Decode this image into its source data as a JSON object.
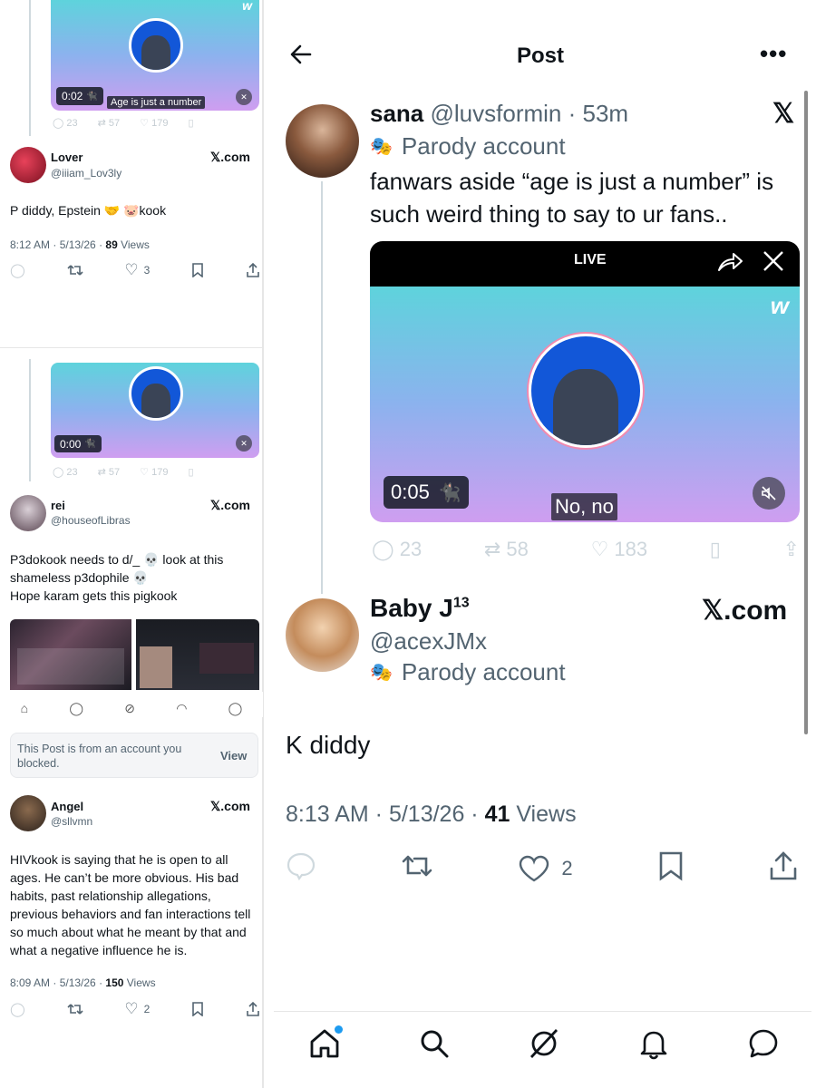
{
  "left": {
    "video1": {
      "time": "0:02",
      "caption": "Age is just a number",
      "stats": [
        "23",
        "57",
        "179"
      ]
    },
    "post1": {
      "name": "Lover",
      "handle": "@iiiam_Lov3ly",
      "badge": "𝕏.com",
      "text": "P diddy, Epstein 🤝 🐷kook",
      "time": "8:12 AM · 5/13/26 · ",
      "views_count": "89",
      "views_label": " Views",
      "likes": "3"
    },
    "video2": {
      "time": "0:00",
      "stats": [
        "23",
        "57",
        "179"
      ]
    },
    "post2": {
      "name": "rei",
      "handle": "@houseofLibras",
      "badge": "𝕏.com",
      "lines": [
        "P3dokook needs to d/_ 💀 look at this",
        "shameless p3dophile 💀",
        "Hope karam gets this pigkook"
      ]
    },
    "blocked": {
      "text": "This Post is from an account you blocked.",
      "view": "View"
    },
    "post3": {
      "name": "Angel",
      "handle": "@sllvmn",
      "badge": "𝕏.com",
      "text": "HIVkook is saying that he is open to all ages. He can’t be more obvious. His bad habits, past relationship allegations, previous behaviors and fan interactions tell so much about what he meant by that and what a negative influence he is.",
      "time": "8:09 AM · 5/13/26 · ",
      "views_count": "150",
      "views_label": " Views",
      "likes": "2"
    }
  },
  "right": {
    "header": {
      "title": "Post"
    },
    "quoted": {
      "name": "sana",
      "handle": "@luvsformin",
      "age": "53m",
      "parody": "Parody account",
      "text": "fanwars aside “age is just a number” is such weird thing to say to ur fans..",
      "live": "LIVE",
      "video_time": "0:05",
      "subtitle": "No, no",
      "stats": [
        "23",
        "58",
        "183"
      ]
    },
    "reply": {
      "name": "Baby J",
      "sup": "13",
      "handle": "@acexJMx",
      "parody": "Parody account",
      "badge": "𝕏.com",
      "text": "K diddy",
      "time": "8:13 AM · 5/13/26 · ",
      "views_count": "41",
      "views_label": " Views",
      "likes": "2"
    }
  }
}
